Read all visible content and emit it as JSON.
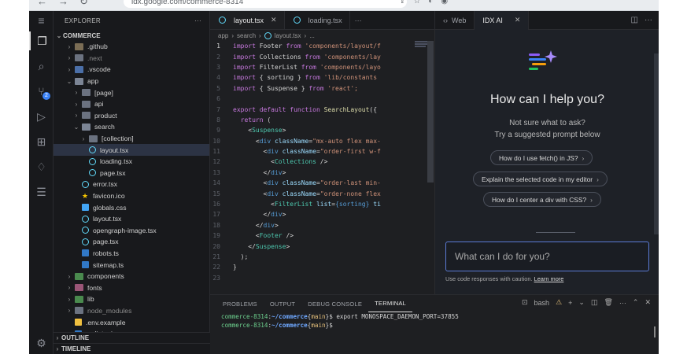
{
  "browser": {
    "url": "idx.google.com/commerce-8314"
  },
  "activity": {
    "scm_badge": "2"
  },
  "explorer": {
    "title": "EXPLORER",
    "more": "···",
    "root": "COMMERCE",
    "items": [
      {
        "label": ".github",
        "depth": 1,
        "type": "folder-git",
        "chev": "›"
      },
      {
        "label": ".next",
        "depth": 1,
        "type": "folder",
        "chev": "›",
        "dim": true
      },
      {
        "label": ".vscode",
        "depth": 1,
        "type": "folder-blue",
        "chev": "›"
      },
      {
        "label": "app",
        "depth": 1,
        "type": "folder-open",
        "chev": "⌄"
      },
      {
        "label": "[page]",
        "depth": 2,
        "type": "folder",
        "chev": "›"
      },
      {
        "label": "api",
        "depth": 2,
        "type": "folder",
        "chev": "›"
      },
      {
        "label": "product",
        "depth": 2,
        "type": "folder",
        "chev": "›"
      },
      {
        "label": "search",
        "depth": 2,
        "type": "folder-open",
        "chev": "⌄"
      },
      {
        "label": "[collection]",
        "depth": 3,
        "type": "folder",
        "chev": "›"
      },
      {
        "label": "layout.tsx",
        "depth": 3,
        "type": "tsx",
        "selected": true
      },
      {
        "label": "loading.tsx",
        "depth": 3,
        "type": "tsx"
      },
      {
        "label": "page.tsx",
        "depth": 3,
        "type": "tsx"
      },
      {
        "label": "error.tsx",
        "depth": 2,
        "type": "tsx"
      },
      {
        "label": "favicon.ico",
        "depth": 2,
        "type": "star"
      },
      {
        "label": "globals.css",
        "depth": 2,
        "type": "css"
      },
      {
        "label": "layout.tsx",
        "depth": 2,
        "type": "tsx"
      },
      {
        "label": "opengraph-image.tsx",
        "depth": 2,
        "type": "tsx"
      },
      {
        "label": "page.tsx",
        "depth": 2,
        "type": "tsx"
      },
      {
        "label": "robots.ts",
        "depth": 2,
        "type": "ts"
      },
      {
        "label": "sitemap.ts",
        "depth": 2,
        "type": "ts"
      },
      {
        "label": "components",
        "depth": 1,
        "type": "folder-green",
        "chev": "›"
      },
      {
        "label": "fonts",
        "depth": 1,
        "type": "folder-pink",
        "chev": "›"
      },
      {
        "label": "lib",
        "depth": 1,
        "type": "folder-green",
        "chev": "›"
      },
      {
        "label": "node_modules",
        "depth": 1,
        "type": "folder",
        "chev": "›",
        "dim": true
      },
      {
        "label": ".env.example",
        "depth": 1,
        "type": "env"
      },
      {
        "label": ".eslintrc.js",
        "depth": 1,
        "type": "ts"
      }
    ],
    "outline": "OUTLINE",
    "timeline": "TIMELINE"
  },
  "editor": {
    "tabs": [
      {
        "label": "layout.tsx",
        "active": true
      },
      {
        "label": "loading.tsx",
        "active": false
      }
    ],
    "breadcrumb": [
      "app",
      "search",
      "layout.tsx",
      "..."
    ],
    "lines": [
      "1",
      "2",
      "3",
      "4",
      "5",
      "6",
      "7",
      "8",
      "9",
      "10",
      "11",
      "12",
      "13",
      "14",
      "15",
      "16",
      "17",
      "18",
      "19",
      "20",
      "21",
      "22",
      "23"
    ],
    "code": {
      "l1a": "import",
      "l1b": " Footer ",
      "l1c": "from",
      "l1d": " 'components/layout/f",
      "l2a": "import",
      "l2b": " Collections ",
      "l2c": "from",
      "l2d": " 'components/lay",
      "l3a": "import",
      "l3b": " FilterList ",
      "l3c": "from",
      "l3d": " 'components/layo",
      "l4a": "import",
      "l4b": " { sorting } ",
      "l4c": "from",
      "l4d": " 'lib/constants",
      "l5a": "import",
      "l5b": " { Suspense } ",
      "l5c": "from",
      "l5d": " 'react';",
      "l7a": "export default function",
      "l7b": " SearchLayout",
      "l7c": "({",
      "l8a": "  return",
      "l8b": " (",
      "l9a": "    <",
      "l9b": "Suspense",
      "l9c": ">",
      "l10a": "      <",
      "l10b": "div",
      "l10c": " className",
      "l10d": "=",
      "l10e": "\"mx-auto flex max-",
      "l11a": "        <",
      "l11b": "div",
      "l11c": " className",
      "l11d": "=",
      "l11e": "\"order-first w-f",
      "l12a": "          <",
      "l12b": "Collections",
      "l12c": " />",
      "l13a": "        </",
      "l13b": "div",
      "l13c": ">",
      "l14a": "        <",
      "l14b": "div",
      "l14c": " className",
      "l14d": "=",
      "l14e": "\"order-last min-",
      "l15a": "        <",
      "l15b": "div",
      "l15c": " className",
      "l15d": "=",
      "l15e": "\"order-none flex",
      "l16a": "          <",
      "l16b": "FilterList",
      "l16c": " list",
      "l16d": "=",
      "l16e": "{sorting}",
      "l16f": " ti",
      "l17a": "        </",
      "l17b": "div",
      "l17c": ">",
      "l18a": "      </",
      "l18b": "div",
      "l18c": ">",
      "l19a": "      <",
      "l19b": "Footer",
      "l19c": " />",
      "l20a": "    </",
      "l20b": "Suspense",
      "l20c": ">",
      "l21a": "  );",
      "l22a": "}"
    }
  },
  "ai_panel": {
    "tabs": [
      {
        "label": "Web"
      },
      {
        "label": "IDX AI"
      }
    ],
    "heading": "How can I help you?",
    "sub1": "Not sure what to ask?",
    "sub2": "Try a suggested prompt below",
    "suggestions": [
      "How do I use fetch() in JS?",
      "Explain the selected code in my editor",
      "How do I center a div with CSS?"
    ],
    "input_placeholder": "What can I do for you?",
    "note": "Use code responses with caution.",
    "note_link": "Learn more",
    "colors": {
      "accent": "#5b7bd5"
    }
  },
  "panel": {
    "tabs": [
      "PROBLEMS",
      "OUTPUT",
      "DEBUG CONSOLE",
      "TERMINAL"
    ],
    "shell": "bash",
    "terminal": [
      {
        "host": "commerce-8314",
        "sep": ":",
        "path": "~/commerce",
        "branch_open": "{",
        "branch": "main",
        "branch_close": "}",
        "dollar": "$ ",
        "cmd": "export MONOSPACE_DAEMON_PORT=37855"
      },
      {
        "host": "commerce-8314",
        "sep": ":",
        "path": "~/commerce",
        "branch_open": "{",
        "branch": "main",
        "branch_close": "}",
        "dollar": "$",
        "cmd": ""
      }
    ]
  }
}
